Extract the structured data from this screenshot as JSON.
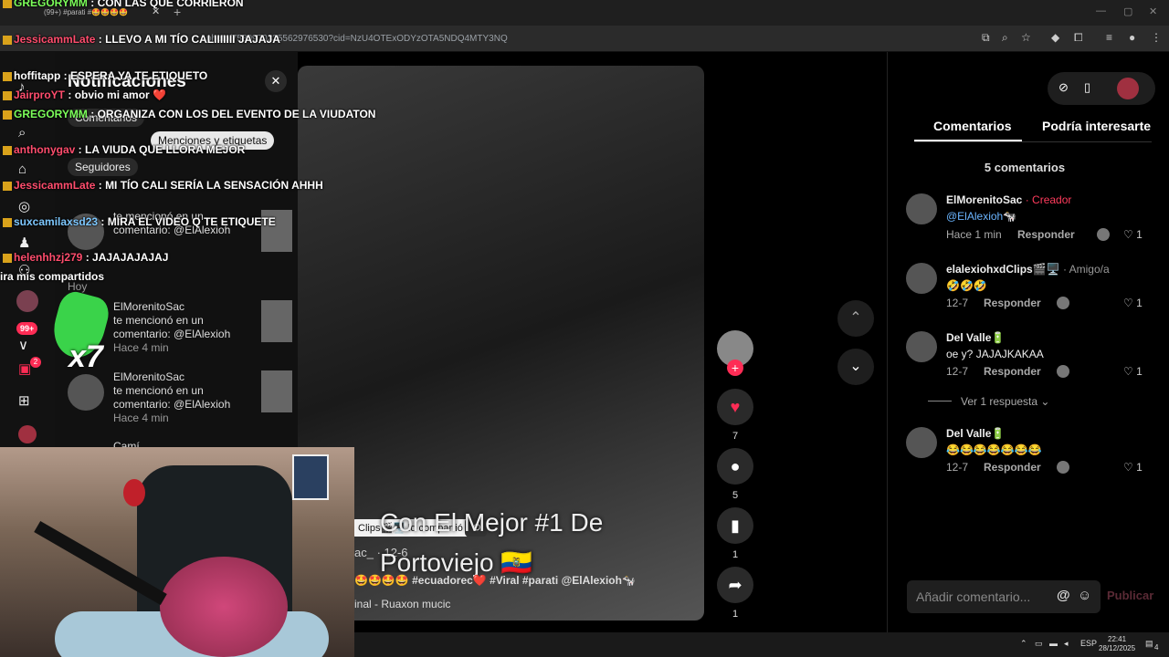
{
  "browser": {
    "tab_title": "(99+) #parati #🤩🤩🤩🤩",
    "url": "photo/7580970335562976530?cid=NzU4OTExODYzOTA5NDQ4MTY3NQ"
  },
  "notifications": {
    "title": "Notificaciones",
    "filters": [
      "Comentarios",
      "Menciones y etiquetas",
      "Seguidores"
    ],
    "section_today": "Hoy",
    "items": [
      {
        "name": "ElMorenitoSac",
        "text": "te mencionó en un comentario: @ElAlexioh",
        "time": "Hace 4 min"
      },
      {
        "name": "ElMorenitoSac",
        "text": "te mencionó en un comentario: @ElAlexioh",
        "time": "Hace 4 min"
      },
      {
        "name": "Camí",
        "text": "",
        "time": ""
      }
    ],
    "partial_row": {
      "text": "te mencionó en un comentario: @ElAlexioh"
    }
  },
  "sidebar": {
    "inbox_badge": "99+",
    "messages_badge": "2"
  },
  "chat": [
    {
      "user": "GREGORYMM",
      "msg": "CON LAS QUE CORRIERON"
    },
    {
      "user": "JessicammLate",
      "msg": "LLEVO A MI TÍO CALIIIIIII JAJAJA"
    },
    {
      "user": "hoffitapp",
      "msg": "ESPERA YA TE ETIQUETO"
    },
    {
      "user": "JairproYT",
      "msg": "obvio mi amor"
    },
    {
      "user": "GREGORYMM",
      "msg": "ORGANIZA CON LOS DEL EVENTO DE LA VIUDATON"
    },
    {
      "user": "anthonygav",
      "msg": "LA VIUDA QUE LLORA MEJOR"
    },
    {
      "user": "JessicammLate",
      "msg": "MI TÍO CALI SERÍA LA SENSACIÓN AHHH"
    },
    {
      "user": "suxcamilaxsd23",
      "msg": "MIRA EL VIDEO Q TE ETIQUETE"
    },
    {
      "user": "helenhhzj279",
      "msg": "JAJAJAJAJAJ"
    }
  ],
  "chat_extra": "ira mis compartidos",
  "overlay": {
    "multiplier": "x7"
  },
  "video": {
    "title_line1": "Con El Mejor #1 De",
    "title_line2": "Portoviejo 🇪🇨",
    "author": "ac_ · 12-6",
    "tags": "🤩🤩🤩🤩 #ecuadorec❤️ #Viral #parati @ElAlexioh🐄",
    "sound": "inal - Ruaxon mucic",
    "shared_label": "Clips🎬🖥️ lo compartió"
  },
  "actions": {
    "likes": "7",
    "comments": "5",
    "saves": "1",
    "shares": "1"
  },
  "comments_panel": {
    "tabs": [
      "Comentarios",
      "Podría interesarte"
    ],
    "count_label": "5 comentarios",
    "comments": [
      {
        "user": "ElMorenitoSac",
        "tag": "· Creador",
        "text": "@ElAlexioh🐄",
        "time": "Hace 1 min",
        "reply": "Responder",
        "likes": "1"
      },
      {
        "user": "elalexiohxdClips🎬🖥️",
        "tag": "· Amigo/a",
        "text": "🤣🤣🤣",
        "time": "12-7",
        "reply": "Responder",
        "likes": "1"
      },
      {
        "user": "Del Valle🔋",
        "tag": "",
        "text": "oe y? JAJAJKAKAA",
        "time": "12-7",
        "reply": "Responder",
        "likes": "1"
      },
      {
        "user": "Del Valle🔋",
        "tag": "",
        "text": "😂😂😂😂😂😂😂",
        "time": "12-7",
        "reply": "Responder",
        "likes": "1"
      }
    ],
    "view_replies": "Ver 1 respuesta",
    "input_placeholder": "Añadir comentario...",
    "publish": "Publicar"
  },
  "taskbar": {
    "lang": "ESP",
    "time": "22:41",
    "date": "28/12/2025",
    "notif_count": "4"
  }
}
